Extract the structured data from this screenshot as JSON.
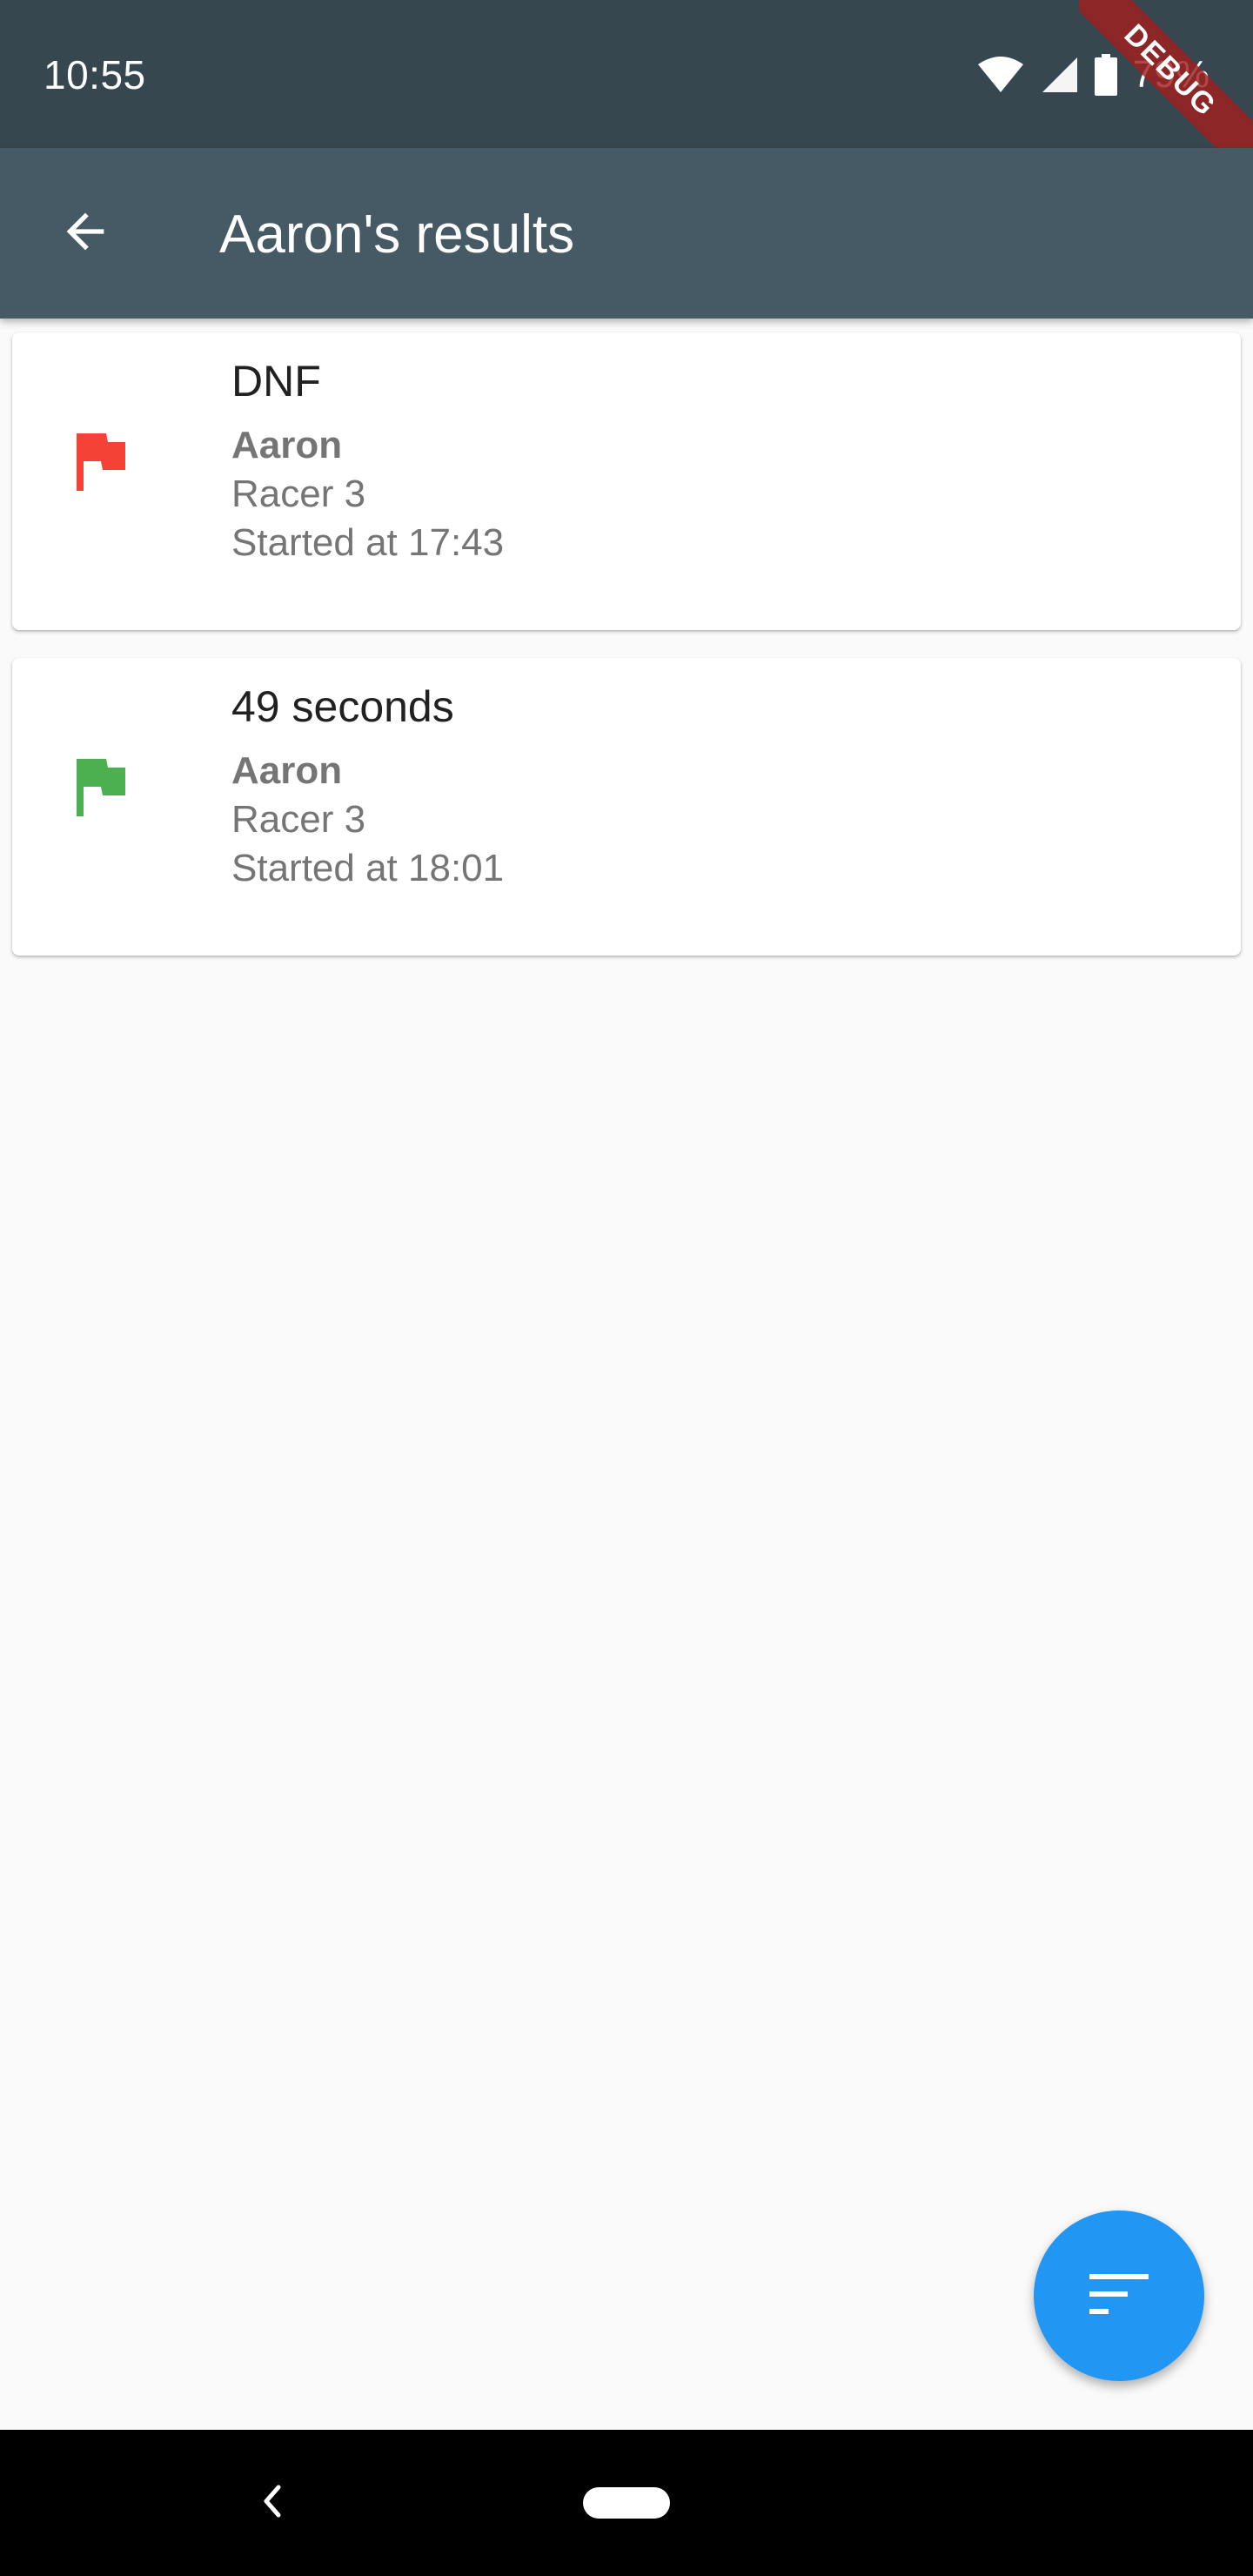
{
  "status_bar": {
    "time": "10:55",
    "battery": "79%",
    "icons": [
      "wifi-icon",
      "signal-icon",
      "battery-icon"
    ]
  },
  "debug_banner": "DEBUG",
  "app_bar": {
    "title": "Aaron's results",
    "back_icon": "arrow-back-icon"
  },
  "results": [
    {
      "time": "DNF",
      "name": "Aaron",
      "racer": "Racer 3",
      "started": "Started at 17:43",
      "flag_color": "#f44336",
      "flag_icon": "flag-icon"
    },
    {
      "time": "49 seconds",
      "name": "Aaron",
      "racer": "Racer 3",
      "started": "Started at 18:01",
      "flag_color": "#4caf50",
      "flag_icon": "flag-icon"
    }
  ],
  "fab": {
    "icon": "sort-icon",
    "color": "#2196f3"
  },
  "nav_bar": {
    "icons": [
      "nav-back-icon",
      "nav-home-pill"
    ]
  },
  "colors": {
    "status_bar": "#37474f",
    "app_bar": "#455a64",
    "background": "#fafafa"
  }
}
